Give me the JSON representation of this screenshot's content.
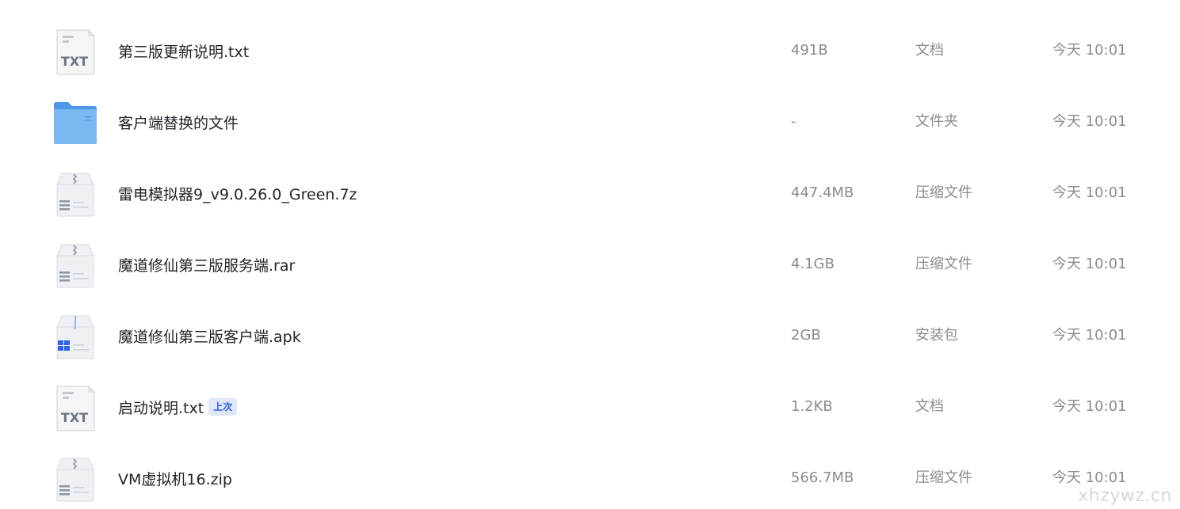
{
  "files": [
    {
      "name": "第三版更新说明.txt",
      "size": "491B",
      "type": "文档",
      "date": "今天 10:01",
      "icon": "txt-file-icon",
      "icon_text": "TXT"
    },
    {
      "name": "客户端替换的文件",
      "size": "-",
      "type": "文件夹",
      "date": "今天 10:01",
      "icon": "folder-icon"
    },
    {
      "name": "雷电模拟器9_v9.0.26.0_Green.7z",
      "size": "447.4MB",
      "type": "压缩文件",
      "date": "今天 10:01",
      "icon": "archive-file-icon"
    },
    {
      "name": "魔道修仙第三版服务端.rar",
      "size": "4.1GB",
      "type": "压缩文件",
      "date": "今天 10:01",
      "icon": "archive-file-icon"
    },
    {
      "name": "魔道修仙第三版客户端.apk",
      "size": "2GB",
      "type": "安装包",
      "date": "今天 10:01",
      "icon": "installer-package-icon"
    },
    {
      "name": "启动说明.txt",
      "badge": "上次",
      "size": "1.2KB",
      "type": "文档",
      "date": "今天 10:01",
      "icon": "txt-file-icon",
      "icon_text": "TXT"
    },
    {
      "name": "VM虚拟机16.zip",
      "size": "566.7MB",
      "type": "压缩文件",
      "date": "今天 10:01",
      "icon": "archive-file-icon"
    }
  ],
  "watermark": "xhzywz.cn",
  "colors": {
    "folder": "#6aaef0",
    "badge_bg": "#dfe7fb",
    "badge_text": "#2f5bdc",
    "installer_blue": "#2f63e0"
  }
}
